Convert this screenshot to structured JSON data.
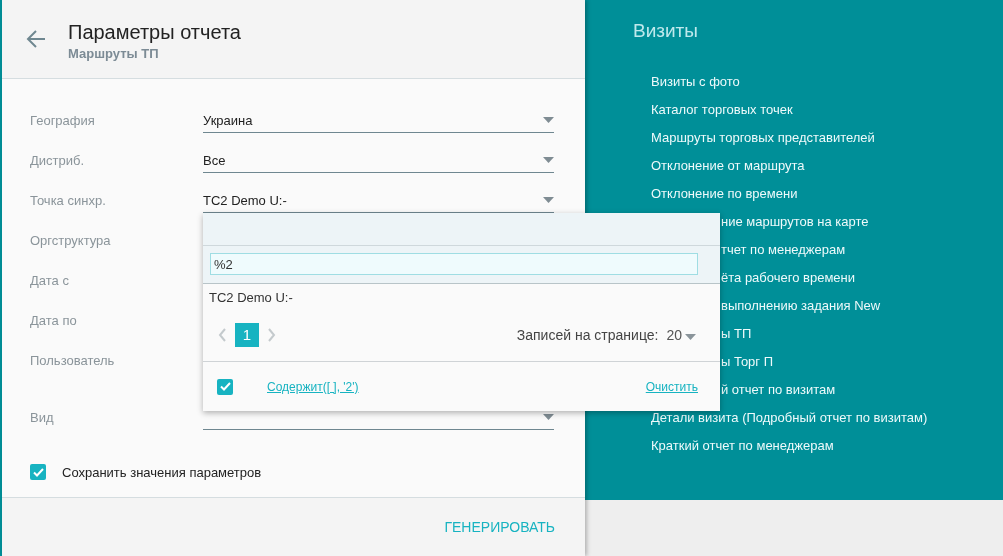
{
  "header": {
    "title": "Параметры отчета",
    "subtitle": "Маршруты ТП"
  },
  "fields": [
    {
      "label": "География",
      "kind": "select",
      "value": "Украина"
    },
    {
      "label": "Дистриб.",
      "kind": "select",
      "value": "Все"
    },
    {
      "label": "Точка синхр.",
      "kind": "select",
      "value": "TC2 Demo U:-"
    },
    {
      "label": "Оргструктура",
      "kind": "covered"
    },
    {
      "label": "Дата с",
      "kind": "covered"
    },
    {
      "label": "Дата по",
      "kind": "covered"
    },
    {
      "label": "Пользователь",
      "kind": "covered_tall"
    },
    {
      "label": "Вид",
      "kind": "select"
    }
  ],
  "save_params": {
    "label": "Сохранить значения параметров",
    "checked": true
  },
  "generate_button": "ГЕНЕРИРОВАТЬ",
  "dropdown": {
    "search_value": "%2",
    "options": [
      "TC2 Demo U:-"
    ],
    "pages": [
      {
        "label": "1",
        "selected": true
      }
    ],
    "per_page_label": "Записей на странице:",
    "per_page": "20",
    "filter": {
      "checked": true,
      "link": "Содержит([ ], '2')"
    },
    "clear_link": "Очистить"
  },
  "sidebar": {
    "title": "Визиты",
    "items": [
      {
        "label": "Визиты с фото",
        "kind": "full"
      },
      {
        "label": "Каталог торговых точек",
        "kind": "full"
      },
      {
        "label": "Маршруты торговых представителей",
        "kind": "full"
      },
      {
        "label": "Отклонение от маршрута",
        "kind": "full"
      },
      {
        "label": "Отклонение по времени",
        "kind": "full"
      },
      {
        "label": "ние маршрутов на карте",
        "kind": "cut"
      },
      {
        "label": "тчет по менеджерам",
        "kind": "cut"
      },
      {
        "label": "ёта рабочего времени",
        "kind": "cut"
      },
      {
        "label": "выполнению задания New",
        "kind": "cut"
      },
      {
        "label": "ы ТП",
        "kind": "cut"
      },
      {
        "label": "ы Торг П",
        "kind": "cut"
      },
      {
        "label": "й отчет по визитам",
        "kind": "cut"
      },
      {
        "label": "Детали визита (Подробный отчет по визитам)",
        "kind": "full"
      },
      {
        "label": "Краткий отчет по менеджерам",
        "kind": "full"
      }
    ]
  }
}
